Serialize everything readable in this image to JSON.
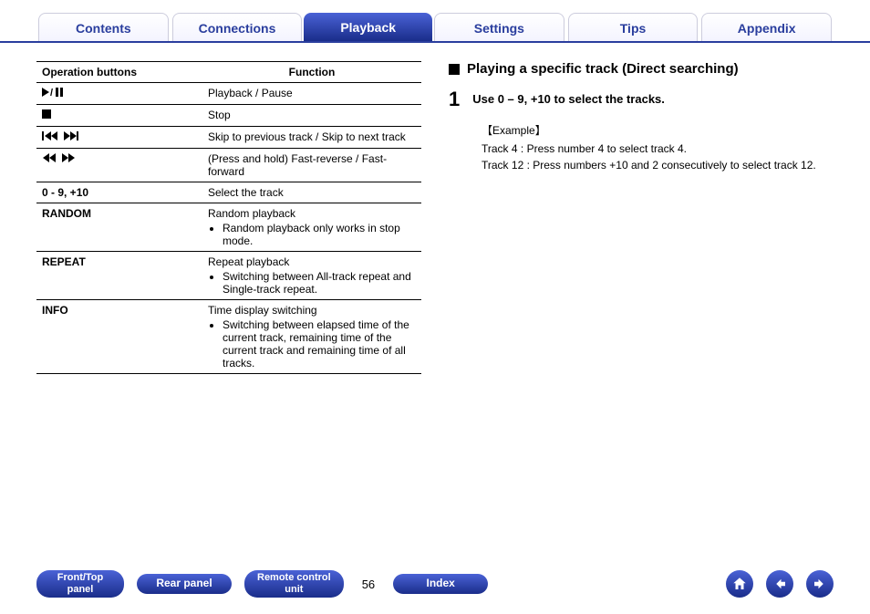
{
  "tabs": [
    {
      "label": "Contents",
      "active": false
    },
    {
      "label": "Connections",
      "active": false
    },
    {
      "label": "Playback",
      "active": true
    },
    {
      "label": "Settings",
      "active": false
    },
    {
      "label": "Tips",
      "active": false
    },
    {
      "label": "Appendix",
      "active": false
    }
  ],
  "table": {
    "headers": [
      "Operation buttons",
      "Function"
    ],
    "rows": [
      {
        "btn_icons": "play-pause",
        "btn_text": "",
        "fn": "Playback / Pause"
      },
      {
        "btn_icons": "stop",
        "btn_text": "",
        "fn": "Stop"
      },
      {
        "btn_icons": "skip",
        "btn_text": "",
        "fn": "Skip to previous track / Skip to next track"
      },
      {
        "btn_icons": "seek",
        "btn_text": "",
        "fn": "(Press and hold) Fast-reverse / Fast-forward"
      },
      {
        "btn_icons": "",
        "btn_text": "0 - 9, +10",
        "fn": "Select the track"
      },
      {
        "btn_icons": "",
        "btn_text": "RANDOM",
        "fn": "Random playback",
        "bullets": [
          "Random playback only works in stop mode."
        ]
      },
      {
        "btn_icons": "",
        "btn_text": "REPEAT",
        "fn": "Repeat playback",
        "bullets": [
          "Switching between All-track repeat and Single-track repeat."
        ]
      },
      {
        "btn_icons": "",
        "btn_text": "INFO",
        "fn": "Time display switching",
        "bullets": [
          "Switching between elapsed time of the current track, remaining time of the current track and remaining time of all tracks."
        ]
      }
    ]
  },
  "right": {
    "title": "Playing a specific track (Direct searching)",
    "step_num": "1",
    "step_text": "Use 0 – 9, +10 to select the tracks.",
    "example_label": "【Example】",
    "example_lines": [
      "Track 4 : Press number 4 to select track 4.",
      "Track 12 : Press numbers +10 and 2 consecutively to select track 12."
    ]
  },
  "footer": {
    "btn1": "Front/Top panel",
    "btn2": "Rear panel",
    "btn3": "Remote control unit",
    "page": "56",
    "btn4": "Index"
  }
}
